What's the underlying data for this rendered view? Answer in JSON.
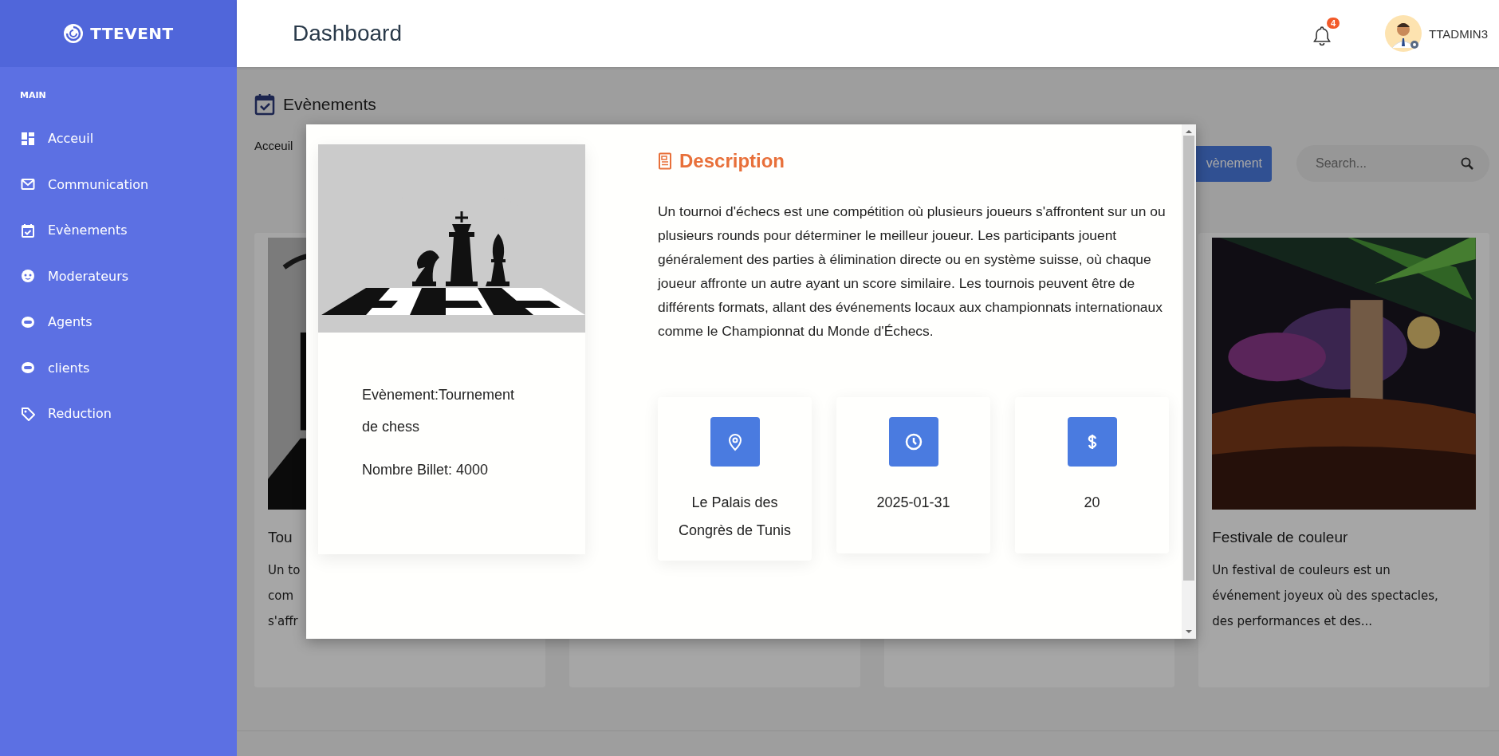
{
  "sidebar": {
    "brand": "TTEVENT",
    "section": "MAIN",
    "items": [
      {
        "label": "Acceuil",
        "selected": false
      },
      {
        "label": "Communication",
        "selected": false
      },
      {
        "label": "Evènements",
        "selected": false
      },
      {
        "label": "Moderateurs",
        "selected": false
      },
      {
        "label": "Agents",
        "selected": false
      },
      {
        "label": "clients",
        "selected": false
      },
      {
        "label": "Reduction",
        "selected": false
      }
    ]
  },
  "header": {
    "title": "Dashboard",
    "notifications": {
      "count": "4"
    },
    "user": {
      "name": "TTADMIN3"
    }
  },
  "page": {
    "title": "Evènements",
    "breadcrumb": "Acceuil",
    "add_button": "vènement",
    "search": {
      "placeholder": "Search..."
    },
    "cards": [
      {
        "kind": "event",
        "title": "Tou",
        "description_lines": [
          "Un to",
          "com",
          "s'affr"
        ]
      },
      {
        "kind": "blank"
      },
      {
        "kind": "blank"
      },
      {
        "kind": "event",
        "title": "Festivale de couleur",
        "description_lines": [
          "Un festival de couleurs est un événement joyeux où des spectacles, des performances et des..."
        ]
      }
    ]
  },
  "modal": {
    "event_name": "Evènement:Tournement de chess",
    "tickets": "Nombre Billet: 4000",
    "description_title": "Description",
    "description": "Un tournoi d'échecs est une compétition où plusieurs joueurs s'affrontent sur un ou plusieurs rounds pour déterminer le meilleur joueur. Les participants jouent généralement des parties à élimination directe ou en système suisse, où chaque joueur affronte un autre ayant un score similaire. Les tournois peuvent être de différents formats, allant des événements locaux aux championnats internationaux comme le Championnat du Monde d'Échecs.",
    "info": [
      {
        "kind": "location",
        "text": "Le Palais des Congrès de Tunis"
      },
      {
        "kind": "date",
        "text": "2025-01-31"
      },
      {
        "kind": "price",
        "text": "20"
      }
    ]
  }
}
